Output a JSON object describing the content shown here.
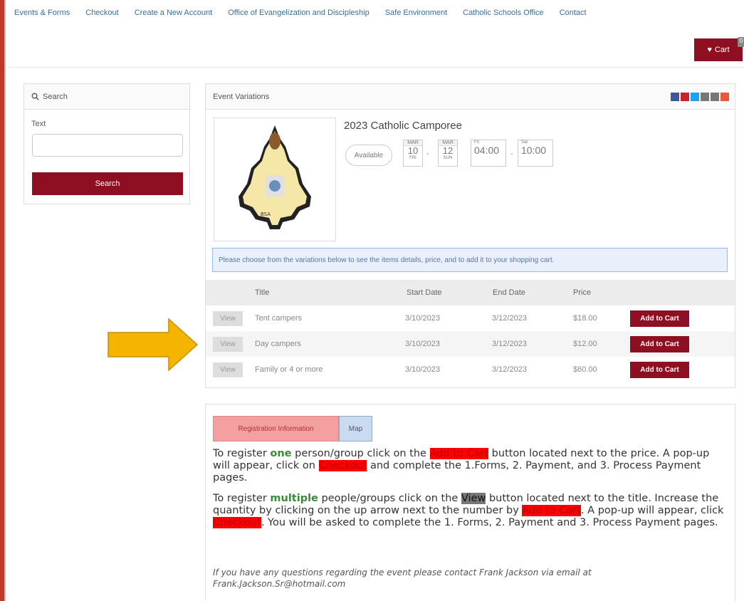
{
  "nav": {
    "links": [
      "Events & Forms",
      "Checkout",
      "Create a New Account",
      "Office of Evangelization and Discipleship",
      "Safe Environment",
      "Catholic Schools Office",
      "Contact"
    ],
    "cart_label": "Cart",
    "cart_count": "0"
  },
  "search": {
    "heading": "Search",
    "text_label": "Text",
    "input_value": "",
    "button_label": "Search"
  },
  "event": {
    "panel_heading": "Event Variations",
    "title": "2023 Catholic Camporee",
    "status": "Available",
    "start": {
      "month": "MAR",
      "day": "10",
      "dow": "FRI"
    },
    "end": {
      "month": "MAR",
      "day": "12",
      "dow": "SUN"
    },
    "start_time": {
      "label": "Fri",
      "time": "04:00"
    },
    "end_time": {
      "label": "Sat",
      "time": "10:00"
    },
    "notice": "Please choose from the variations below to see the items details, price, and to add it to your shopping cart.",
    "columns": {
      "title": "Title",
      "start": "Start Date",
      "end": "End Date",
      "price": "Price"
    },
    "variations": [
      {
        "view": "View",
        "title": "Tent campers",
        "start": "3/10/2023",
        "end": "3/12/2023",
        "price": "$18.00",
        "add": "Add to Cart"
      },
      {
        "view": "View",
        "title": "Day campers",
        "start": "3/10/2023",
        "end": "3/12/2023",
        "price": "$12.00",
        "add": "Add to Cart"
      },
      {
        "view": "View",
        "title": "Family or 4 or more",
        "start": "3/10/2023",
        "end": "3/12/2023",
        "price": "$60.00",
        "add": "Add to Cart"
      }
    ],
    "share_colors": [
      "#3b5998",
      "#cb2027",
      "#1da1f2",
      "#777777",
      "#777777",
      "#e8593c"
    ]
  },
  "registration": {
    "tabs": [
      "Registration Information",
      "Map"
    ],
    "p1": {
      "a": "To register ",
      "one": "one",
      "b": " person/group click on the ",
      "add": "Add to Cart",
      "c": " button located next to the price. A pop-up will appear, click on ",
      "checkout": "Checkout",
      "d": " and complete the 1.Forms, 2. Payment, and 3. Process Payment pages."
    },
    "p2": {
      "a": "To register ",
      "multiple": "multiple",
      "b": " people/groups click on the ",
      "view": "View",
      "c": " button located next to the title. Increase the quantity by clicking on the up arrow next to the number by ",
      "add": "Add to Cart",
      "d": ". A pop-up will appear, click ",
      "checkout": "Checkout",
      "e": ". You will be asked to complete the 1. Forms, 2. Payment and 3. Process Payment pages."
    },
    "note": "If you have any questions regarding the event please contact Frank Jackson via email at Frank.Jackson.Sr@hotmail.com"
  }
}
